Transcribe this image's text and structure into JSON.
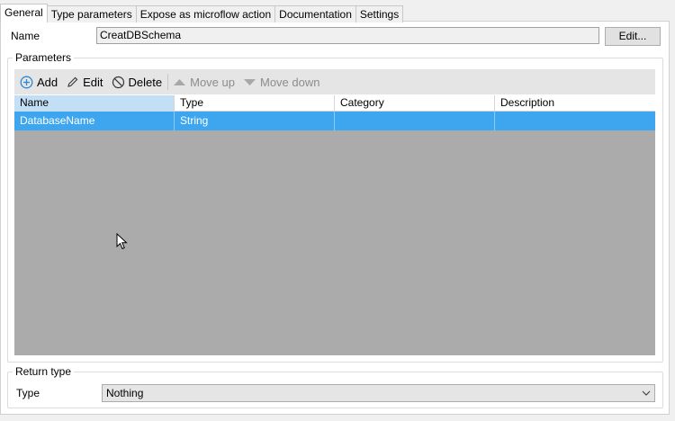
{
  "tabs": [
    "General",
    "Type parameters",
    "Expose as microflow action",
    "Documentation",
    "Settings"
  ],
  "general": {
    "name_label": "Name",
    "name_value": "CreatDBSchema",
    "edit_button": "Edit..."
  },
  "parameters": {
    "group_title": "Parameters",
    "toolbar": {
      "add": "Add",
      "edit": "Edit",
      "delete": "Delete",
      "move_up": "Move up",
      "move_down": "Move down"
    },
    "columns": [
      "Name",
      "Type",
      "Category",
      "Description"
    ],
    "rows": [
      {
        "name": "DatabaseName",
        "type": "String",
        "category": "",
        "description": ""
      }
    ]
  },
  "return_type": {
    "group_title": "Return type",
    "type_label": "Type",
    "type_value": "Nothing"
  },
  "icons": [
    "add-icon",
    "edit-pencil-icon",
    "delete-icon",
    "move-up-icon",
    "move-down-icon",
    "chevron-down-icon",
    "mouse-cursor-icon"
  ],
  "colors": {
    "selection": "#3ea6ee",
    "selected_header": "#c2dff5",
    "grid_empty": "#ababab"
  }
}
